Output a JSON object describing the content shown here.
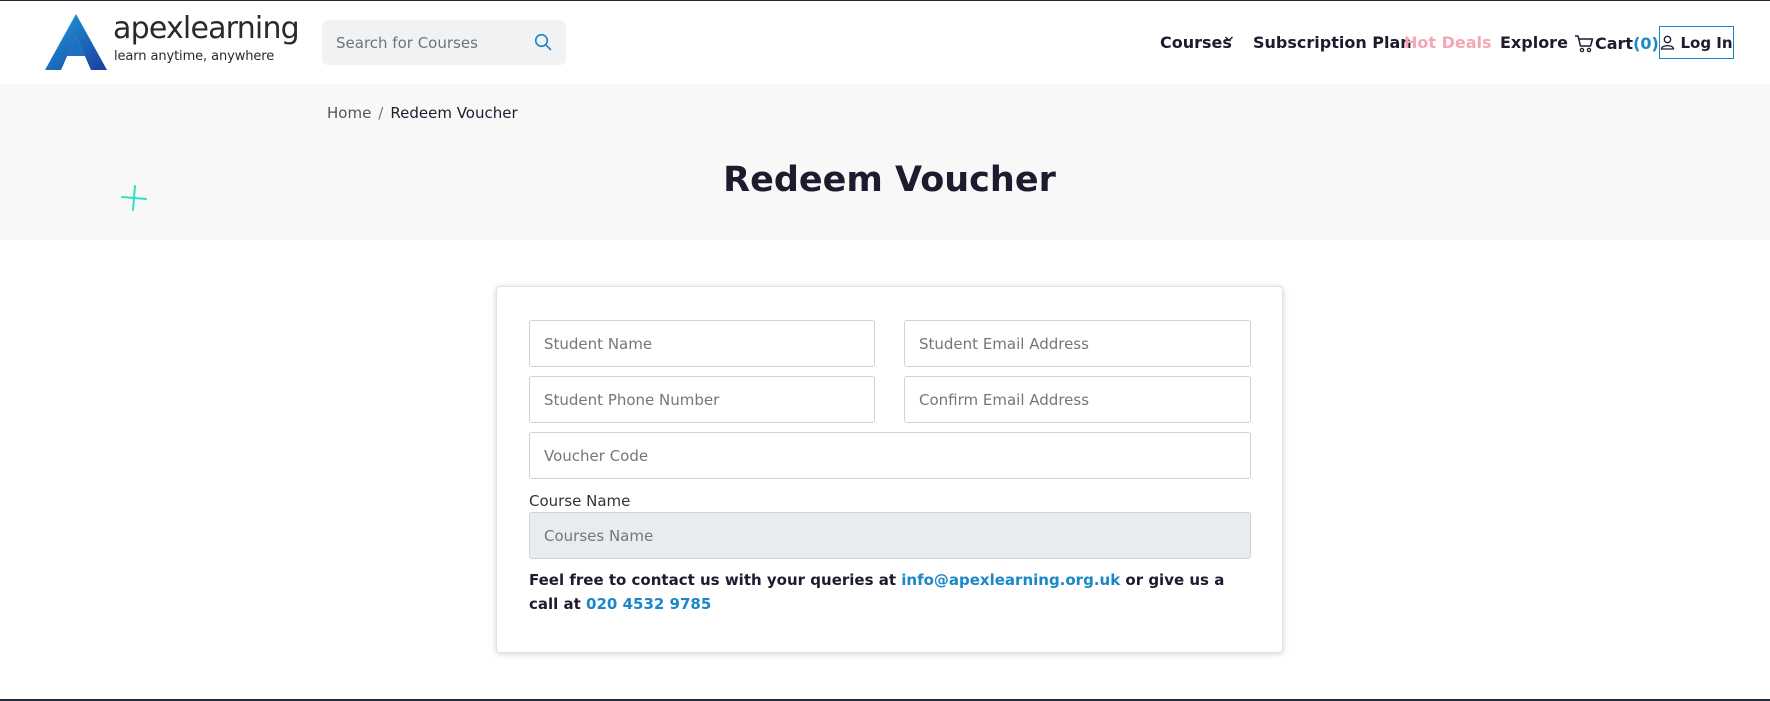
{
  "brand": {
    "name": "apexlearning",
    "tagline": "learn anytime, anywhere"
  },
  "search": {
    "placeholder": "Search for Courses"
  },
  "nav": {
    "courses": "Courses",
    "subscription": "Subscription Plan",
    "hot_deals": "Hot Deals",
    "explore": "Explore",
    "cart_label": "Cart",
    "cart_count": "(0)",
    "login": "Log In"
  },
  "breadcrumb": {
    "home": "Home",
    "separator": "/",
    "current": "Redeem Voucher"
  },
  "page": {
    "title": "Redeem Voucher"
  },
  "form": {
    "student_name_placeholder": "Student Name",
    "student_email_placeholder": "Student Email Address",
    "phone_placeholder": "Student Phone Number",
    "confirm_email_placeholder": "Confirm Email Address",
    "voucher_placeholder": "Voucher Code",
    "course_label": "Course Name",
    "course_placeholder": "Courses Name",
    "contact_text_1": "Feel free to contact us with your queries at ",
    "contact_email": "info@apexlearning.org.uk",
    "contact_text_2": " or give us a call at ",
    "contact_phone": "020 4532 9785"
  },
  "colors": {
    "accent": "#1a87c9",
    "hot_deals": "#f4a7b6",
    "heading": "#1d1b2e",
    "hero_bg": "#f8f8f8",
    "decor_plus": "#2ee0c8"
  }
}
